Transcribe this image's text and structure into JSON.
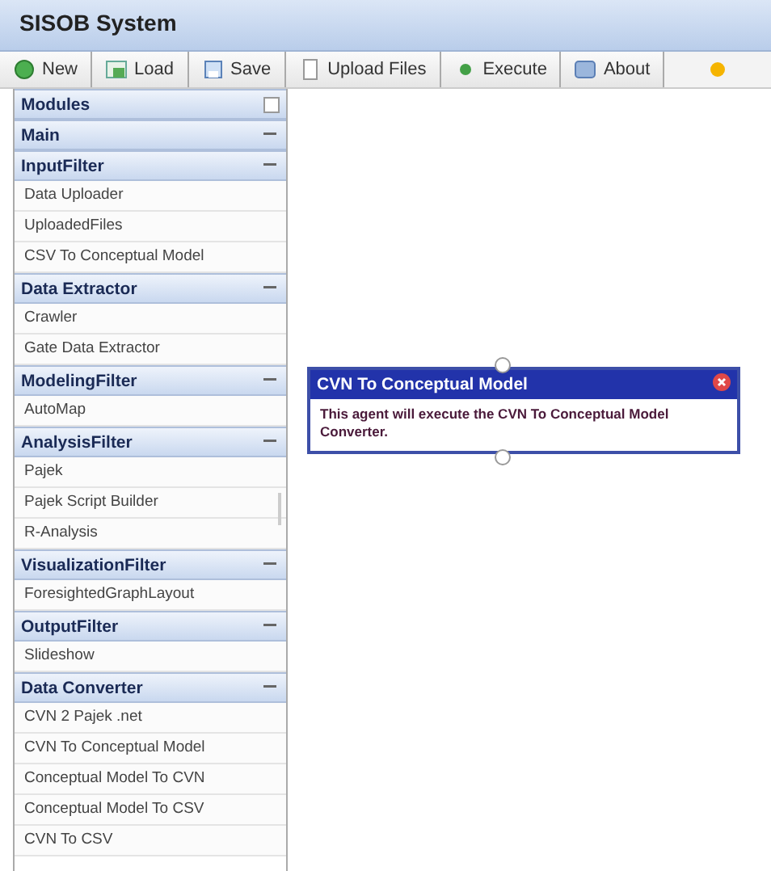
{
  "window": {
    "title": "SISOB System"
  },
  "toolbar": [
    {
      "label": "New",
      "kind": "new"
    },
    {
      "label": "Load",
      "kind": "load"
    },
    {
      "label": "Save",
      "kind": "save"
    },
    {
      "label": "Upload Files",
      "kind": "upload"
    },
    {
      "label": "Execute",
      "kind": "execute"
    },
    {
      "label": "About",
      "kind": "about"
    }
  ],
  "sidebar": {
    "title": "Modules",
    "sections": [
      {
        "title": "Main",
        "expanded": true
      },
      {
        "title": "InputFilter",
        "expanded": true,
        "items": [
          "Data Uploader",
          "UploadedFiles",
          "CSV To Conceptual Model"
        ]
      },
      {
        "title": "Data Extractor",
        "expanded": true,
        "items": [
          "Crawler",
          "Gate Data Extractor"
        ]
      },
      {
        "title": "ModelingFilter",
        "expanded": true,
        "items": [
          "AutoMap"
        ]
      },
      {
        "title": "AnalysisFilter",
        "expanded": true,
        "items": [
          "Pajek",
          "Pajek Script Builder",
          "R-Analysis"
        ]
      },
      {
        "title": "VisualizationFilter",
        "expanded": true,
        "items": [
          "ForesightedGraphLayout"
        ]
      },
      {
        "title": "OutputFilter",
        "expanded": true,
        "items": [
          "Slideshow"
        ]
      },
      {
        "title": "Data Converter",
        "expanded": true,
        "items": [
          "CVN 2 Pajek .net",
          "CVN To Conceptual Model",
          "Conceptual Model To CVN",
          "Conceptual Model To CSV",
          "CVN To CSV"
        ]
      }
    ]
  },
  "canvas": {
    "node": {
      "title": "CVN To Conceptual Model",
      "description": "This agent will execute the CVN To Conceptual Model Converter."
    }
  }
}
